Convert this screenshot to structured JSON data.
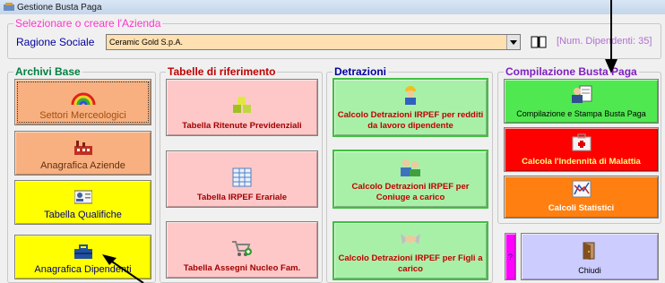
{
  "window": {
    "title": "Gestione Busta Paga"
  },
  "azienda": {
    "group_title": "Selezionare o creare l'Azienda",
    "label": "Ragione Sociale",
    "value": "Ceramic Gold S.p.A.",
    "num_dipendenti": "[Num. Dipendenti: 35]"
  },
  "archivi": {
    "title": "Archivi Base",
    "buttons": [
      {
        "label": "Settori Merceologici",
        "icon": "rainbow-icon"
      },
      {
        "label": "Anagrafica Aziende",
        "icon": "factory-icon"
      },
      {
        "label": "Tabella Qualifiche",
        "icon": "id-card-icon"
      },
      {
        "label": "Anagrafica Dipendenti",
        "icon": "toolbox-icon"
      }
    ]
  },
  "tabelle": {
    "title": "Tabelle di riferimento",
    "buttons": [
      {
        "label": "Tabella Ritenute Previdenziali",
        "icon": "cubes-icon"
      },
      {
        "label": "Tabella IRPEF Erariale",
        "icon": "spreadsheet-icon"
      },
      {
        "label": "Tabella Assegni Nucleo Fam.",
        "icon": "cart-add-icon"
      }
    ]
  },
  "detrazioni": {
    "title": "Detrazioni",
    "buttons": [
      {
        "label": "Calcolo Detrazioni IRPEF per redditi da lavoro dipendente",
        "icon": "worker-icon"
      },
      {
        "label": "Calcolo Detrazioni IRPEF per Coniuge a carico",
        "icon": "couple-icon"
      },
      {
        "label": "Calcolo Detrazioni IRPEF per Figli a carico",
        "icon": "handshake-icon"
      }
    ]
  },
  "compilazione": {
    "title": "Compilazione Busta Paga",
    "buttons": [
      {
        "label": "Compilazione e Stampa Busta Paga",
        "icon": "person-document-icon"
      },
      {
        "label": "Calcola l'Indennità di Malattia",
        "icon": "first-aid-icon"
      },
      {
        "label": "Calcoli Statistici",
        "icon": "chart-icon"
      }
    ]
  },
  "help": {
    "label": "?"
  },
  "chiudi": {
    "label": "Chiudi",
    "icon": "exit-door-icon"
  },
  "colors": {
    "orange": "#f8b080",
    "yellow": "#ffff00",
    "pink": "#ffc8c8",
    "light_green": "#a8f0a8",
    "green": "#50e850",
    "red": "#ff0000",
    "dark_orange": "#ff8010",
    "lavender": "#ccccff",
    "magenta": "#ff00ff"
  }
}
